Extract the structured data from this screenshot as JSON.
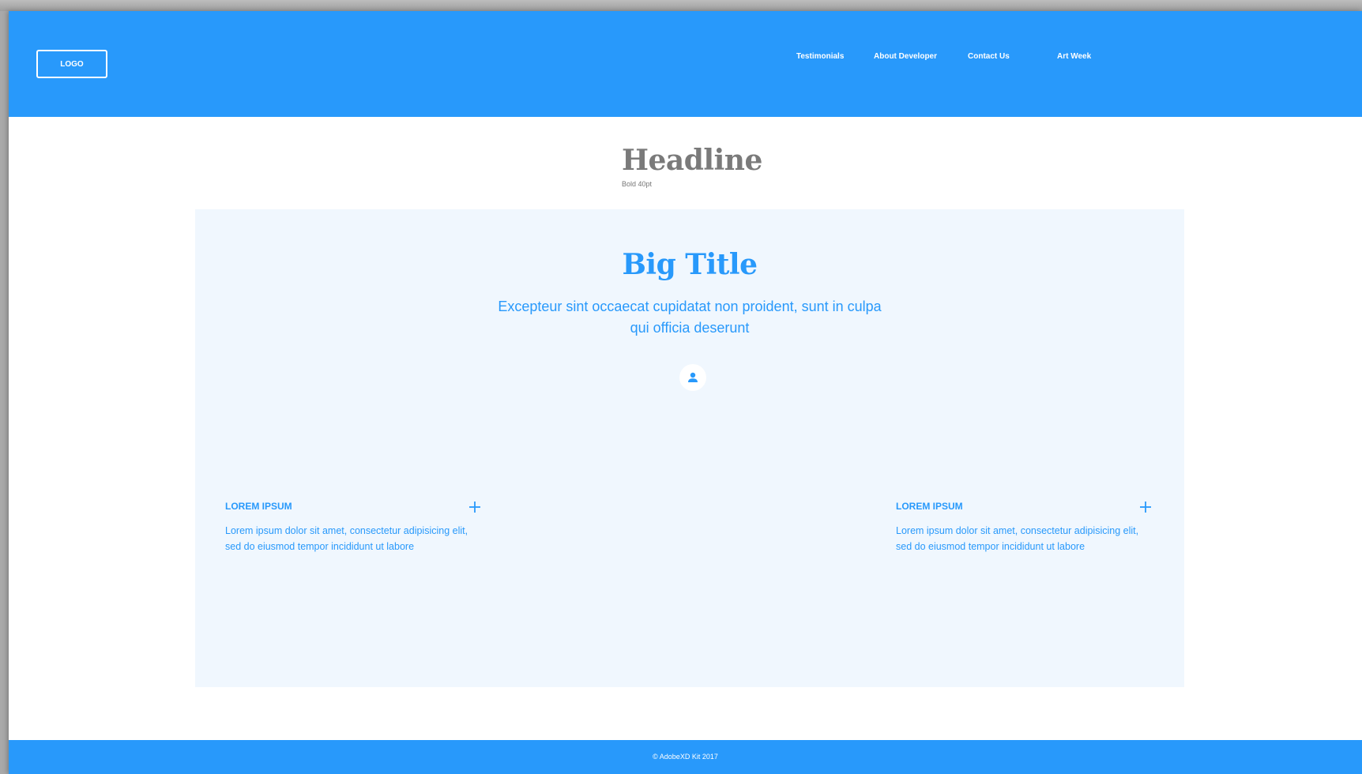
{
  "header": {
    "logo_label": "LOGO",
    "nav": [
      {
        "label": "Testimonials"
      },
      {
        "label": "About Developer"
      },
      {
        "label": "Contact Us"
      },
      {
        "label": "Art Week"
      }
    ]
  },
  "intro": {
    "headline": "Headline",
    "headline_note": "Bold 40pt"
  },
  "panel": {
    "title": "Big Title",
    "subtitle": "Excepteur sint occaecat cupidatat non proident, sunt in culpa qui officia deserunt",
    "avatar_icon": "user-icon",
    "features": [
      {
        "title": "LOREM IPSUM",
        "text": "Lorem ipsum dolor sit amet, consectetur adipisicing elit, sed do eiusmod tempor incididunt ut labore",
        "icon": "plus-icon"
      },
      {
        "title": "LOREM IPSUM",
        "text": "Lorem ipsum dolor sit amet, consectetur adipisicing elit, sed do eiusmod tempor incididunt ut labore",
        "icon": "plus-icon"
      }
    ]
  },
  "footer": {
    "copyright": "© AdobeXD Kit 2017"
  },
  "colors": {
    "brand": "#2899fb",
    "panel_background": "#f0f7fe",
    "headline": "#7a7a7a"
  }
}
